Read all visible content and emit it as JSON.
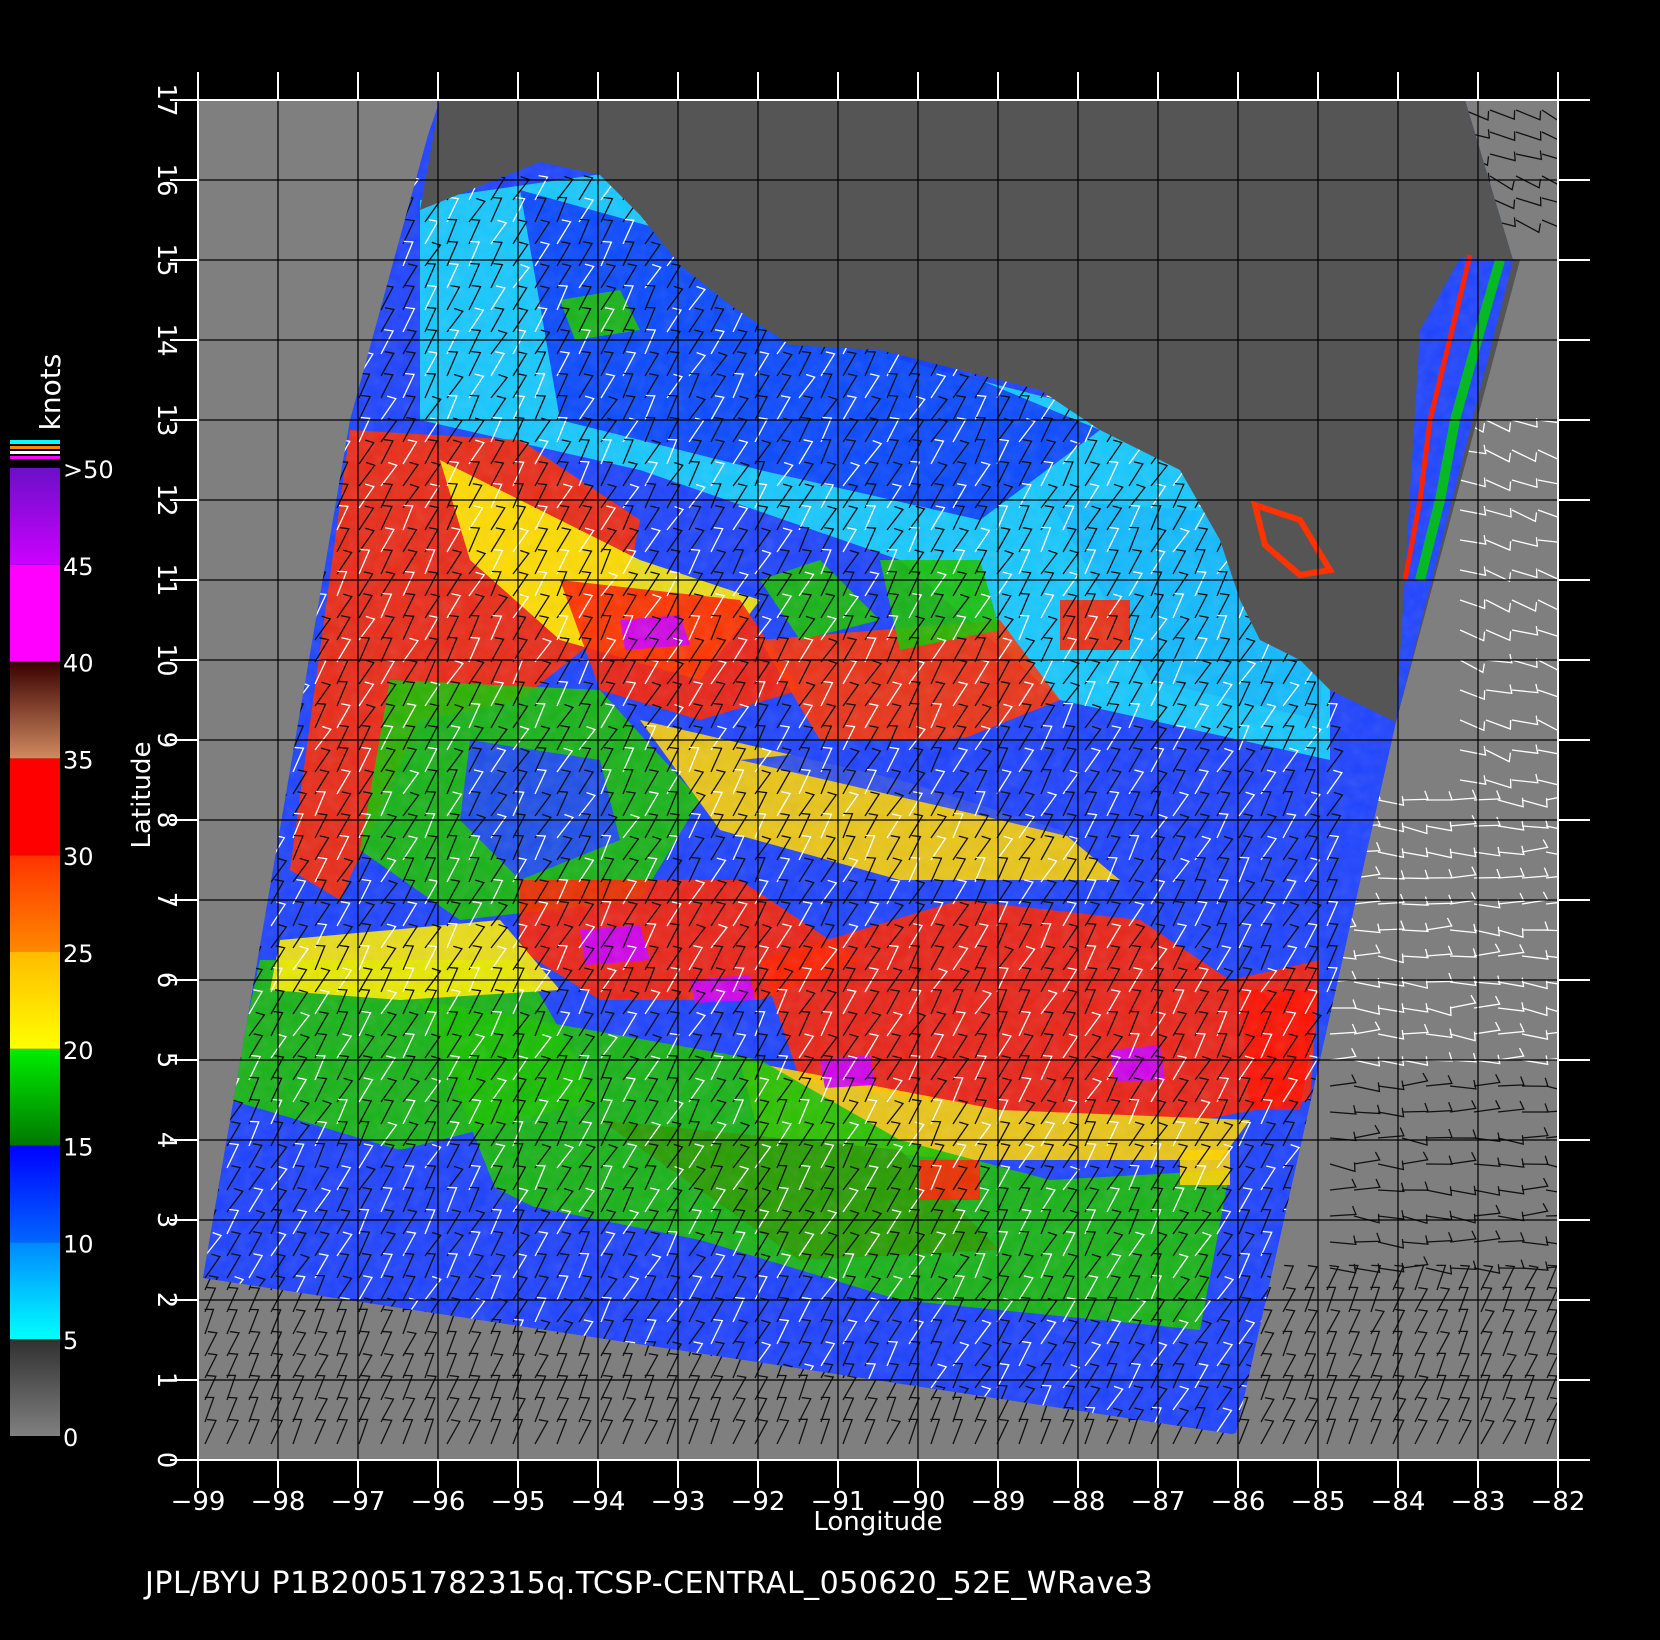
{
  "map": {
    "x_axis_label": "Longitude",
    "y_axis_label": "Latitude",
    "x_range": [
      -99,
      -82
    ],
    "y_range": [
      0,
      17
    ],
    "x_ticks": [
      "−99",
      "−98",
      "−97",
      "−96",
      "−95",
      "−94",
      "−93",
      "−92",
      "−91",
      "−90",
      "−89",
      "−88",
      "−87",
      "−86",
      "−85",
      "−84",
      "−83",
      "−82"
    ],
    "y_ticks": [
      "0",
      "1",
      "2",
      "3",
      "4",
      "5",
      "6",
      "7",
      "8",
      "9",
      "10",
      "11",
      "12",
      "13",
      "14",
      "15",
      "16",
      "17"
    ],
    "grid": true,
    "background_color": "#7f7f7f",
    "land_color": "#555555"
  },
  "colorbar": {
    "unit": "knots",
    "labels": [
      "0",
      "5",
      "10",
      "15",
      "20",
      "25",
      "30",
      "35",
      "40",
      "45",
      ">50"
    ],
    "segments": [
      {
        "from": 0,
        "to": 5,
        "colors": [
          "#808080",
          "#303030"
        ]
      },
      {
        "from": 5,
        "to": 10,
        "colors": [
          "#00ffff",
          "#0088ff"
        ]
      },
      {
        "from": 10,
        "to": 15,
        "colors": [
          "#0066ff",
          "#0000ff"
        ]
      },
      {
        "from": 15,
        "to": 20,
        "colors": [
          "#007700",
          "#00ee00"
        ]
      },
      {
        "from": 20,
        "to": 25,
        "colors": [
          "#ffff00",
          "#ffbb00"
        ]
      },
      {
        "from": 25,
        "to": 30,
        "colors": [
          "#ff8800",
          "#ff3300"
        ]
      },
      {
        "from": 30,
        "to": 35,
        "colors": [
          "#ff0000",
          "#ff0000"
        ]
      },
      {
        "from": 35,
        "to": 40,
        "colors": [
          "#d08a60",
          "#3a0000"
        ]
      },
      {
        "from": 40,
        "to": 45,
        "colors": [
          "#ff00ff",
          "#ff00ff"
        ]
      },
      {
        "from": 45,
        "to": 50,
        "colors": [
          "#cc00ff",
          "#6a10c8"
        ]
      }
    ]
  },
  "footer": "JPL/BYU  P1B20051782315q.TCSP-CENTRAL_050620_52E_WRave3"
}
